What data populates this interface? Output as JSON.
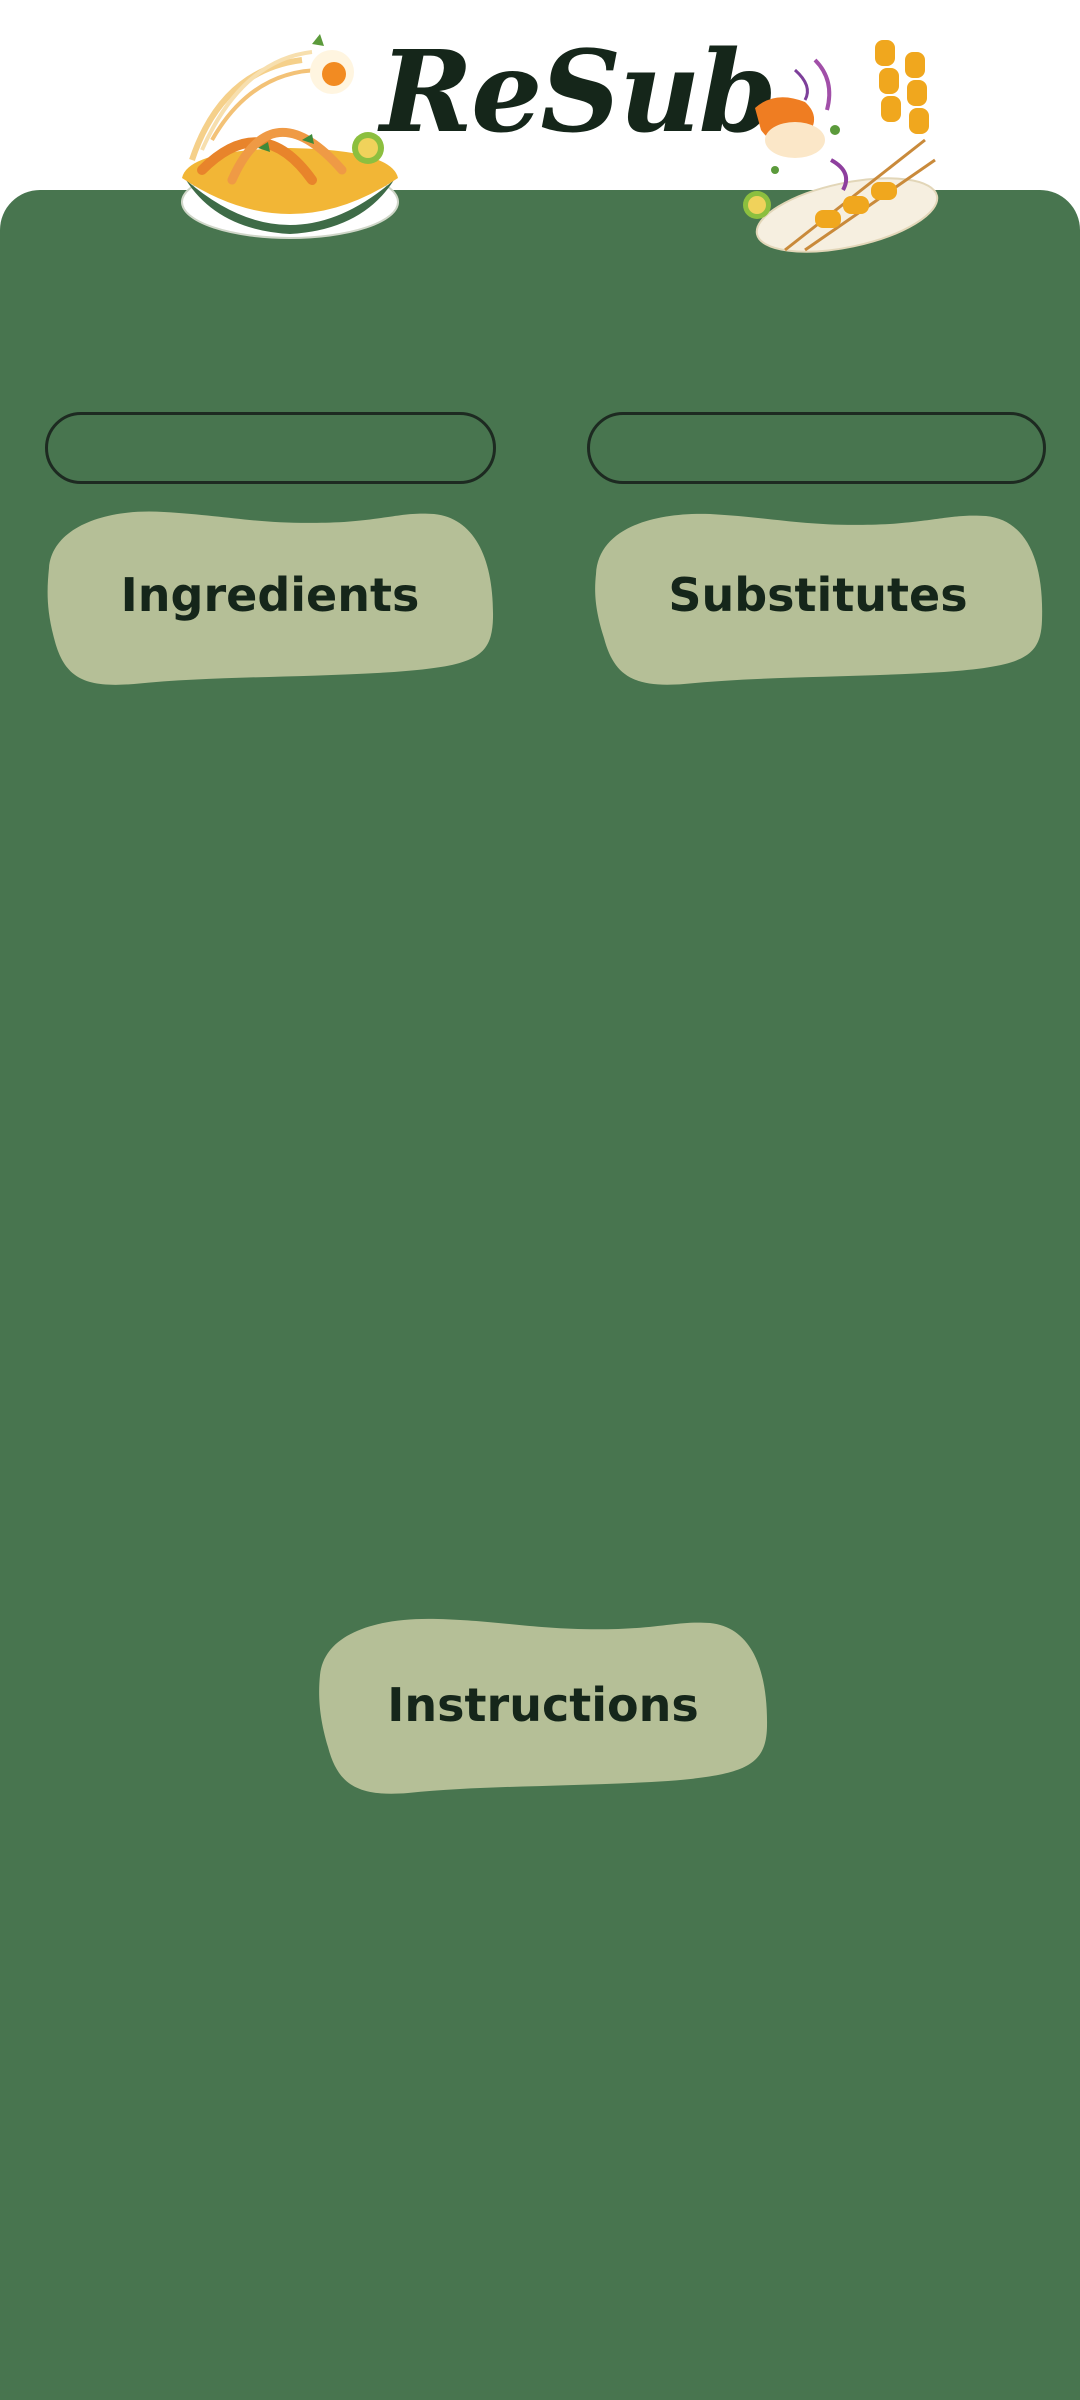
{
  "app": {
    "title": "ReSub"
  },
  "illustrations": {
    "left": "noodle-bowl-illustration",
    "right": "satay-skewers-illustration"
  },
  "search": {
    "ingredient_value": "",
    "substitute_value": ""
  },
  "buttons": {
    "ingredients": "Ingredients",
    "substitutes": "Substitutes",
    "instructions": "Instructions"
  },
  "colors": {
    "panel": "#48754f",
    "button_blob": "#b5bf97",
    "text_dark": "#15261a",
    "field_border": "#1d2a21"
  }
}
